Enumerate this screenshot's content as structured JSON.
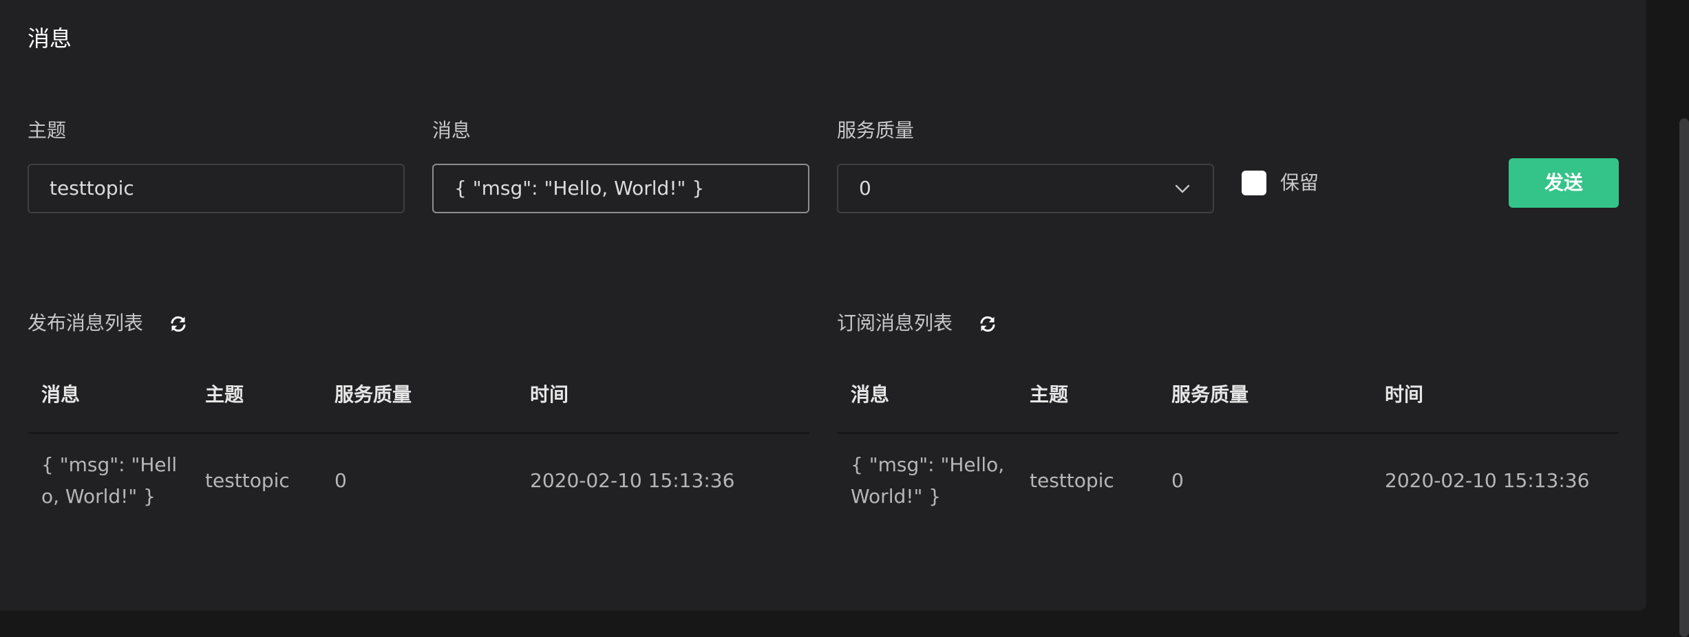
{
  "page": {
    "title": "消息"
  },
  "form": {
    "topic": {
      "label": "主题",
      "value": "testtopic"
    },
    "message": {
      "label": "消息",
      "value": "{ \"msg\": \"Hello, World!\" }"
    },
    "qos": {
      "label": "服务质量",
      "value": "0"
    },
    "retain": {
      "label": "保留",
      "checked": false
    },
    "send_label": "发送"
  },
  "publish_list": {
    "title": "发布消息列表",
    "columns": [
      "消息",
      "主题",
      "服务质量",
      "时间"
    ],
    "rows": [
      {
        "message": "{ \"msg\": \"Hello, World!\" }",
        "topic": "testtopic",
        "qos": "0",
        "time": "2020-02-10 15:13:36"
      }
    ]
  },
  "subscribe_list": {
    "title": "订阅消息列表",
    "columns": [
      "消息",
      "主题",
      "服务质量",
      "时间"
    ],
    "rows": [
      {
        "message": "{ \"msg\": \"Hello, World!\" }",
        "topic": "testtopic",
        "qos": "0",
        "time": "2020-02-10 15:13:36"
      }
    ]
  },
  "colors": {
    "background": "#212022",
    "page_background": "#171717",
    "accent": "#34c388",
    "text": "#c8c8ca",
    "header_text": "#e6e6e6",
    "input_border": "#3f3e42"
  },
  "icons": {
    "select_arrow": "chevron-down-icon",
    "refresh": "refresh-icon"
  }
}
